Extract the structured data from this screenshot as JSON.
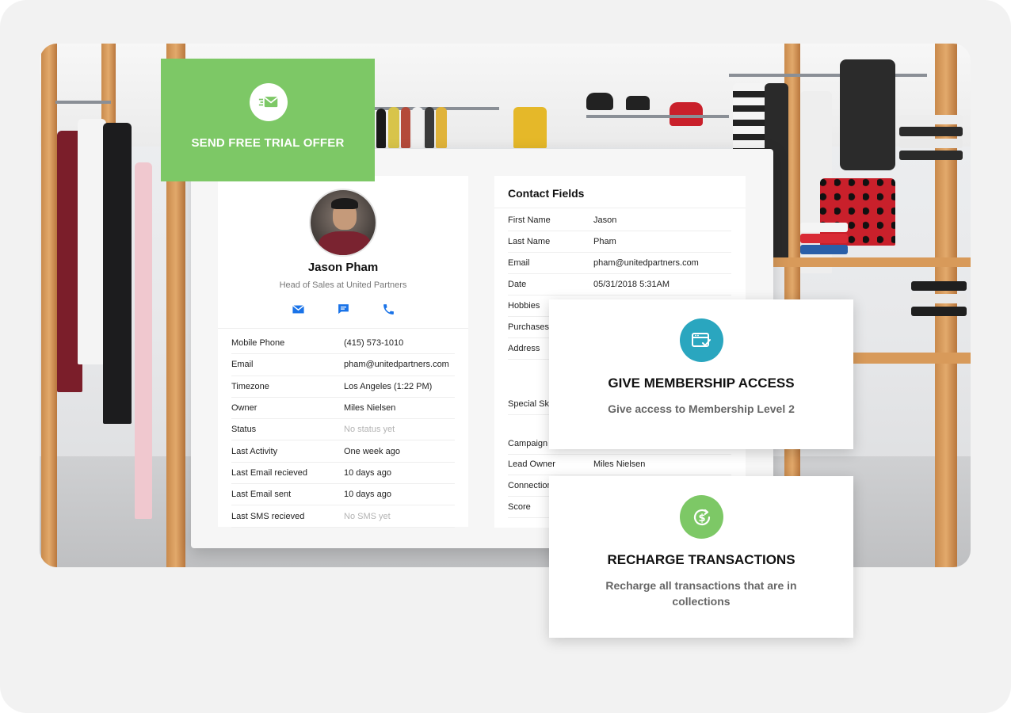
{
  "offer": {
    "label": "SEND FREE TRIAL OFFER",
    "icon": "envelope-send-icon",
    "color": "#7dc866"
  },
  "profile": {
    "name": "Jason Pham",
    "role": "Head of Sales at United Partners",
    "actions": [
      "email-icon",
      "sms-icon",
      "phone-icon"
    ],
    "rows": [
      {
        "label": "Mobile Phone",
        "value": "(415) 573-1010",
        "muted": false
      },
      {
        "label": "Email",
        "value": "pham@unitedpartners.com",
        "muted": false
      },
      {
        "label": "Timezone",
        "value": "Los Angeles (1:22 PM)",
        "muted": false
      },
      {
        "label": "Owner",
        "value": "Miles Nielsen",
        "muted": false
      },
      {
        "label": "Status",
        "value": "No status yet",
        "muted": true
      },
      {
        "label": "Last Activity",
        "value": "One week ago",
        "muted": false
      },
      {
        "label": "Last Email recieved",
        "value": "10 days ago",
        "muted": false
      },
      {
        "label": "Last Email sent",
        "value": "10 days ago",
        "muted": false
      },
      {
        "label": "Last SMS recieved",
        "value": "No SMS yet",
        "muted": true
      }
    ]
  },
  "contact": {
    "title": "Contact Fields",
    "rows": [
      {
        "label": "First Name",
        "value": "Jason"
      },
      {
        "label": "Last Name",
        "value": "Pham"
      },
      {
        "label": "Email",
        "value": "pham@unitedpartners.com"
      },
      {
        "label": "Date",
        "value": "05/31/2018 5:31AM"
      },
      {
        "label": "Hobbies",
        "value": ""
      },
      {
        "label": "Purchases",
        "value": ""
      },
      {
        "label": "Address",
        "value": ""
      },
      {
        "label": "Special Ski",
        "value": ""
      },
      {
        "label": "Campaign",
        "value": ""
      },
      {
        "label": "Lead Owner",
        "value": "Miles Nielsen"
      },
      {
        "label": "Connection",
        "value": ""
      },
      {
        "label": "Score",
        "value": ""
      }
    ]
  },
  "membership": {
    "title": "GIVE MEMBERSHIP ACCESS",
    "description": "Give access to Membership Level 2",
    "icon": "browser-check-icon",
    "color": "#2aa6bf"
  },
  "recharge": {
    "title": "RECHARGE TRANSACTIONS",
    "description": "Recharge all transactions that are in collections",
    "icon": "dollar-refresh-icon",
    "color": "#7dc866"
  },
  "accent": "#1a73e8"
}
